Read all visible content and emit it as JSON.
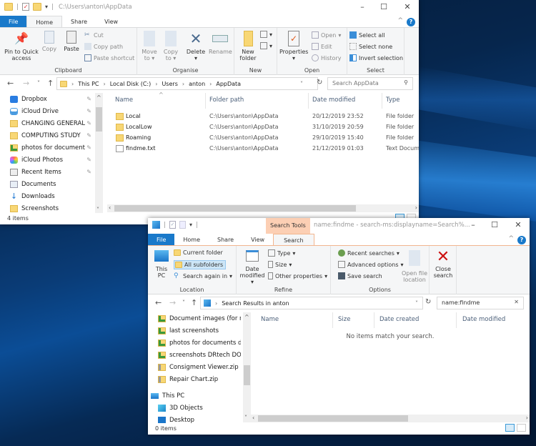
{
  "window1": {
    "title": "C:\\Users\\anton\\AppData",
    "tabs": [
      {
        "label": "File"
      },
      {
        "label": "Home"
      },
      {
        "label": "Share"
      },
      {
        "label": "View"
      }
    ],
    "ribbon": {
      "clipboard": {
        "label": "Clipboard",
        "pin": "Pin to Quick access",
        "copy": "Copy",
        "paste": "Paste",
        "cut": "Cut",
        "copy_path": "Copy path",
        "paste_shortcut": "Paste shortcut"
      },
      "organise": {
        "label": "Organise",
        "move_to": "Move to",
        "copy_to": "Copy to",
        "delete": "Delete",
        "rename": "Rename"
      },
      "new": {
        "label": "New",
        "new_folder": "New folder"
      },
      "open": {
        "label": "Open",
        "properties": "Properties",
        "open": "Open",
        "edit": "Edit",
        "history": "History"
      },
      "select": {
        "label": "Select",
        "select_all": "Select all",
        "select_none": "Select none",
        "invert": "Invert selection"
      }
    },
    "breadcrumb": [
      "This PC",
      "Local Disk (C:)",
      "Users",
      "anton",
      "AppData"
    ],
    "search_placeholder": "Search AppData",
    "nav_items": [
      {
        "label": "Dropbox",
        "icon": "dropbox-icon",
        "pinned": true
      },
      {
        "label": "iCloud Drive",
        "icon": "icloud-icon",
        "pinned": true
      },
      {
        "label": "CHANGING GENERAL",
        "icon": "folder-icon",
        "pinned": true
      },
      {
        "label": "COMPUTING STUDY",
        "icon": "folder-icon",
        "pinned": true
      },
      {
        "label": "photos for document",
        "icon": "folder-synced-icon",
        "pinned": true
      },
      {
        "label": "iCloud Photos",
        "icon": "icloud-photos-icon",
        "pinned": true
      },
      {
        "label": "Recent Items",
        "icon": "recent-items-icon",
        "pinned": true
      },
      {
        "label": "Documents",
        "icon": "documents-icon",
        "pinned": false
      },
      {
        "label": "Downloads",
        "icon": "downloads-icon",
        "pinned": false
      },
      {
        "label": "Screenshots",
        "icon": "folder-icon",
        "pinned": false
      }
    ],
    "columns": [
      "Name",
      "Folder path",
      "Date modified",
      "Type"
    ],
    "files": [
      {
        "name": "Local",
        "path": "C:\\Users\\anton\\AppData",
        "date": "20/12/2019 23:52",
        "type": "File folder",
        "icon": "folder"
      },
      {
        "name": "LocalLow",
        "path": "C:\\Users\\anton\\AppData",
        "date": "31/10/2019 20:59",
        "type": "File folder",
        "icon": "folder"
      },
      {
        "name": "Roaming",
        "path": "C:\\Users\\anton\\AppData",
        "date": "29/10/2019 15:40",
        "type": "File folder",
        "icon": "folder"
      },
      {
        "name": "findme.txt",
        "path": "C:\\Users\\anton\\AppData",
        "date": "21/12/2019 01:03",
        "type": "Text Docum",
        "icon": "text"
      }
    ],
    "status": "4 items"
  },
  "window2": {
    "context_tab": "Search Tools",
    "title": "name:findme - search-ms:displayname=Search%...",
    "tabs": [
      {
        "label": "File"
      },
      {
        "label": "Home"
      },
      {
        "label": "Share"
      },
      {
        "label": "View"
      },
      {
        "label": "Search"
      }
    ],
    "ribbon": {
      "location": {
        "label": "Location",
        "this_pc": "This PC",
        "current_folder": "Current folder",
        "all_subfolders": "All subfolders",
        "search_again": "Search again in"
      },
      "refine": {
        "label": "Refine",
        "date_modified": "Date modified",
        "type": "Type",
        "size": "Size",
        "other": "Other properties"
      },
      "options": {
        "label": "Options",
        "recent": "Recent searches",
        "advanced": "Advanced options",
        "save": "Save search",
        "open_location": "Open file location"
      },
      "close": {
        "close_search": "Close search"
      }
    },
    "breadcrumb": [
      "Search Results in anton"
    ],
    "search_value": "name:findme",
    "nav_items": [
      {
        "label": "Document images (for n",
        "icon": "folder-synced-icon"
      },
      {
        "label": "last screenshots",
        "icon": "folder-synced-icon"
      },
      {
        "label": "photos for documents d",
        "icon": "folder-synced-icon"
      },
      {
        "label": "screenshots DRtech DON",
        "icon": "folder-synced-icon"
      },
      {
        "label": "Consigment Viewer.zip",
        "icon": "zip-icon"
      },
      {
        "label": "Repair Chart.zip",
        "icon": "zip-icon"
      },
      {
        "label": "This PC",
        "icon": "this-pc-icon"
      },
      {
        "label": "3D Objects",
        "icon": "3d-objects-icon"
      },
      {
        "label": "Desktop",
        "icon": "desktop-icon"
      }
    ],
    "columns": [
      "Name",
      "Size",
      "Date created",
      "Date modified"
    ],
    "empty_message": "No items match your search.",
    "status": "0 items"
  }
}
